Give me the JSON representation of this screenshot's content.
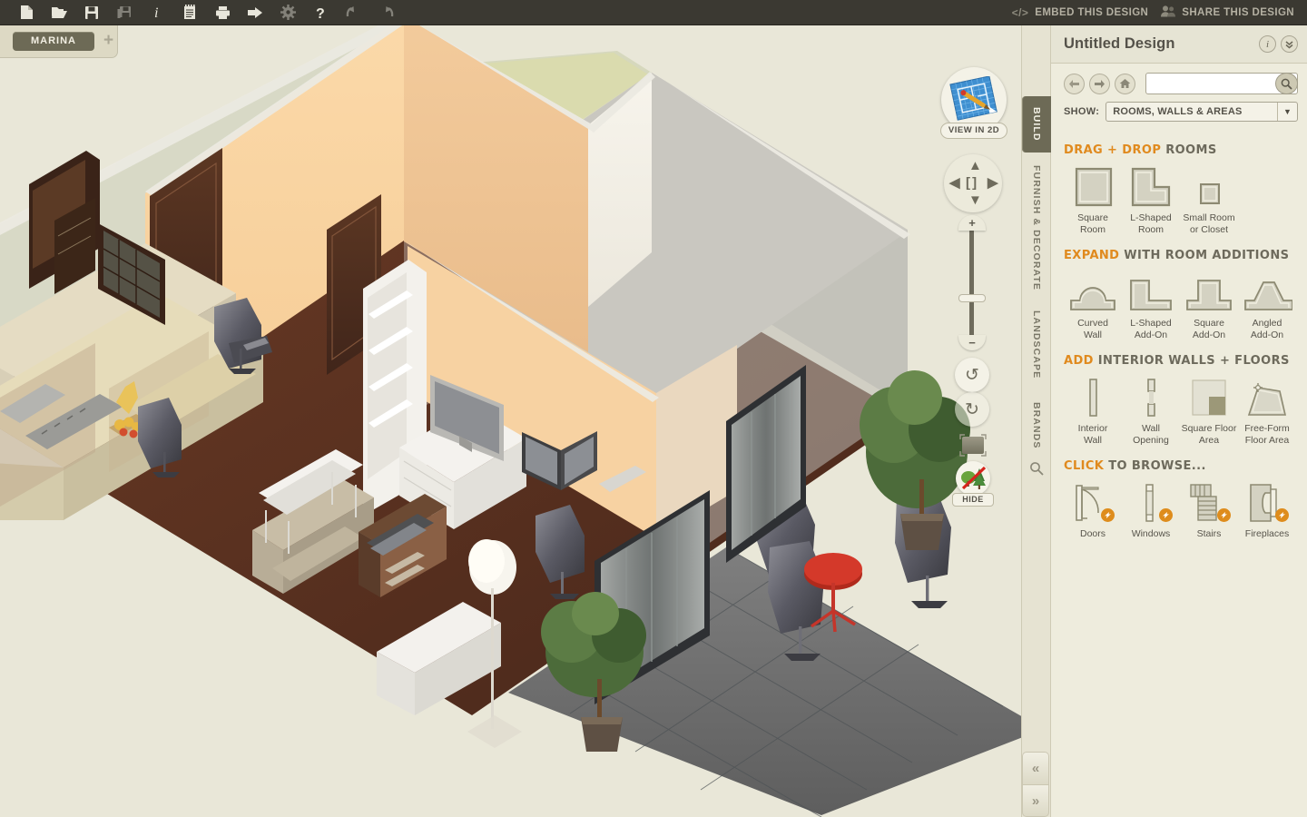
{
  "topbar": {
    "tools": [
      {
        "name": "new-file-icon",
        "label": "New",
        "dim": false
      },
      {
        "name": "open-folder-icon",
        "label": "Open",
        "dim": false
      },
      {
        "name": "save-icon",
        "label": "Save",
        "dim": false
      },
      {
        "name": "save-as-icon",
        "label": "Save As",
        "dim": true
      },
      {
        "name": "info-icon",
        "label": "Info",
        "dim": false
      },
      {
        "name": "notes-icon",
        "label": "Notes",
        "dim": false
      },
      {
        "name": "print-icon",
        "label": "Print",
        "dim": false
      },
      {
        "name": "export-icon",
        "label": "Export",
        "dim": false
      },
      {
        "name": "settings-gear-icon",
        "label": "Settings",
        "dim": true
      },
      {
        "name": "help-icon",
        "label": "Help",
        "dim": false
      },
      {
        "name": "undo-icon",
        "label": "Undo",
        "dim": true
      },
      {
        "name": "redo-icon",
        "label": "Redo",
        "dim": true
      }
    ],
    "embed_label": "EMBED THIS DESIGN",
    "share_label": "SHARE THIS DESIGN"
  },
  "tabstrip": {
    "active_tab": "MARINA",
    "add_tab": "+"
  },
  "viewport": {
    "view_in_2d_label": "VIEW IN 2D",
    "hide_label": "HIDE",
    "pad_center": "[ ]",
    "zoom_plus": "+",
    "zoom_minus": "−",
    "rotate_ccw": "↺",
    "rotate_cw": "↻"
  },
  "side_tabs": [
    {
      "label": "BUILD",
      "active": true
    },
    {
      "label": "FURNISH & DECORATE",
      "active": false
    },
    {
      "label": "LANDSCAPE",
      "active": false
    },
    {
      "label": "BRANDS",
      "active": false
    }
  ],
  "side_search_icon": "search-icon",
  "panel": {
    "title": "Untitled Design",
    "info_icon": "i",
    "collapse_icon": "»",
    "nav": {
      "back": "←",
      "forward": "→",
      "home": "⌂"
    },
    "search": {
      "value": "",
      "placeholder": ""
    },
    "show_label": "SHOW:",
    "show_value": "ROOMS, WALLS & AREAS",
    "sections": [
      {
        "id": "drag-drop-rooms",
        "accent": "DRAG + DROP",
        "rest": " ROOMS",
        "items": [
          {
            "name": "square-room",
            "caption": "Square\nRoom",
            "icon": "square-room-icon"
          },
          {
            "name": "l-shaped-room",
            "caption": "L-Shaped\nRoom",
            "icon": "l-shaped-room-icon"
          },
          {
            "name": "small-room-or-closet",
            "caption": "Small Room\nor Closet",
            "icon": "small-room-icon"
          }
        ]
      },
      {
        "id": "expand-room-additions",
        "accent": "EXPAND",
        "rest": " WITH ROOM ADDITIONS",
        "items": [
          {
            "name": "curved-wall",
            "caption": "Curved\nWall",
            "icon": "curved-wall-icon"
          },
          {
            "name": "l-shaped-add-on",
            "caption": "L-Shaped\nAdd-On",
            "icon": "l-shaped-addon-icon"
          },
          {
            "name": "square-add-on",
            "caption": "Square\nAdd-On",
            "icon": "square-addon-icon"
          },
          {
            "name": "angled-add-on",
            "caption": "Angled\nAdd-On",
            "icon": "angled-addon-icon"
          }
        ]
      },
      {
        "id": "add-interior-walls-floors",
        "accent": "ADD",
        "rest": " INTERIOR WALLS + FLOORS",
        "items": [
          {
            "name": "interior-wall",
            "caption": "Interior\nWall",
            "icon": "interior-wall-icon"
          },
          {
            "name": "wall-opening",
            "caption": "Wall\nOpening",
            "icon": "wall-opening-icon"
          },
          {
            "name": "square-floor-area",
            "caption": "Square Floor\nArea",
            "icon": "square-floor-area-icon"
          },
          {
            "name": "free-form-floor-area",
            "caption": "Free-Form\nFloor Area",
            "icon": "free-form-floor-area-icon"
          }
        ]
      },
      {
        "id": "click-to-browse",
        "accent": "CLICK",
        "rest": " TO BROWSE...",
        "items": [
          {
            "name": "doors",
            "caption": "Doors",
            "icon": "door-icon",
            "badge": true
          },
          {
            "name": "windows",
            "caption": "Windows",
            "icon": "window-icon",
            "badge": true
          },
          {
            "name": "stairs",
            "caption": "Stairs",
            "icon": "stairs-icon",
            "badge": true
          },
          {
            "name": "fireplaces",
            "caption": "Fireplaces",
            "icon": "fireplace-icon",
            "badge": true
          }
        ]
      }
    ]
  },
  "collapse": {
    "left": "«",
    "right": "»"
  },
  "colors": {
    "accent": "#e08a1e",
    "toolbar_bg": "#3b3932",
    "panel_bg": "#eeecdd",
    "canvas_bg": "#e9e7d8",
    "active_tab": "#6d6a56"
  }
}
